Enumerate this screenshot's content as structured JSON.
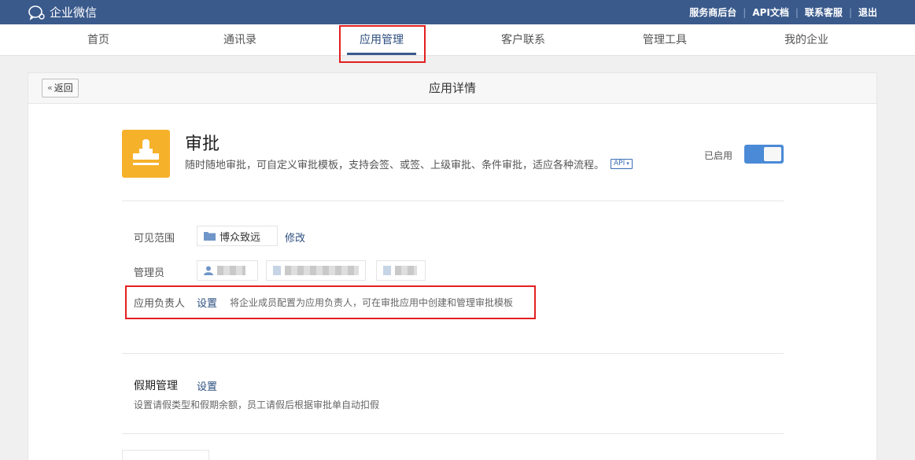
{
  "topbar": {
    "logo_text": "企业微信",
    "links": [
      "服务商后台",
      "API文档",
      "联系客服",
      "退出"
    ]
  },
  "nav": {
    "items": [
      "首页",
      "通讯录",
      "应用管理",
      "客户联系",
      "管理工具",
      "我的企业"
    ],
    "active": "应用管理"
  },
  "panel": {
    "back_label": "返回",
    "title": "应用详情"
  },
  "app": {
    "name": "审批",
    "description": "随时随地审批，可自定义审批模板，支持会签、或签、上级审批、条件审批，适应各种流程。",
    "api_badge": "API",
    "status_label": "已启用",
    "enabled": true,
    "icon_color": "#f6b12b"
  },
  "visibility": {
    "label": "可见范围",
    "scope_value": "博众致远",
    "edit_label": "修改"
  },
  "admins": {
    "label": "管理员"
  },
  "owner": {
    "label": "应用负责人",
    "set_label": "设置",
    "hint": "将企业成员配置为应用负责人，可在审批应用中创建和管理审批模板"
  },
  "leave": {
    "title": "假期管理",
    "set_label": "设置",
    "hint": "设置请假类型和假期余额，员工请假后根据审批单自动扣假"
  },
  "colors": {
    "topbar": "#3a5a8c",
    "accent": "#4a8ad6",
    "highlight": "#e32020"
  }
}
